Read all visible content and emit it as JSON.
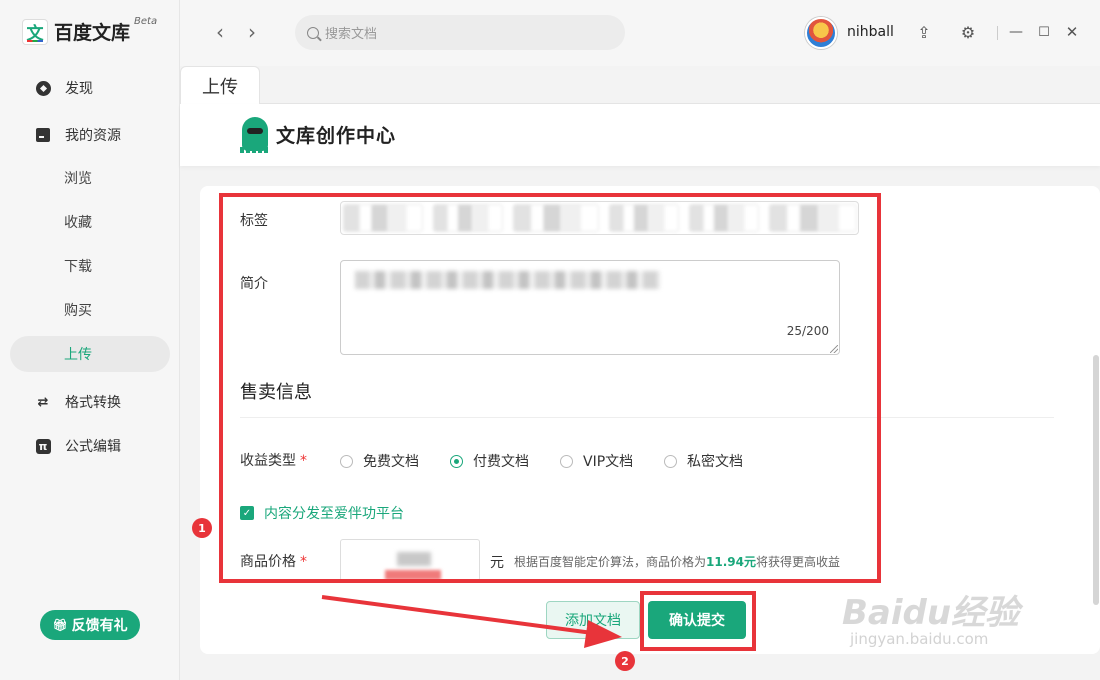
{
  "app": {
    "name": "百度文库",
    "beta": "Beta",
    "logo_char": "文"
  },
  "sidebar": {
    "items": [
      {
        "label": "发现",
        "icon": "compass-icon"
      },
      {
        "label": "我的资源",
        "icon": "folder-icon"
      },
      {
        "label": "浏览"
      },
      {
        "label": "收藏"
      },
      {
        "label": "下载"
      },
      {
        "label": "购买"
      },
      {
        "label": "上传",
        "active": true
      },
      {
        "label": "格式转换",
        "icon": "swap-icon"
      },
      {
        "label": "公式编辑",
        "icon": "formula-icon"
      }
    ],
    "feedback_label": "反馈有礼"
  },
  "topbar": {
    "search_placeholder": "搜索文档",
    "username": "nihball"
  },
  "tab": {
    "label": "上传"
  },
  "studio": {
    "name": "文库创作中心"
  },
  "form": {
    "tags_label": "标签",
    "intro_label": "简介",
    "intro_counter": "25/200",
    "sale_section_title": "售卖信息",
    "revenue_type_label": "收益类型",
    "required_mark": "*",
    "revenue_options": [
      {
        "label": "免费文档",
        "selected": false
      },
      {
        "label": "付费文档",
        "selected": true
      },
      {
        "label": "VIP文档",
        "selected": false
      },
      {
        "label": "私密文档",
        "selected": false
      }
    ],
    "distribute_checkbox": {
      "label": "内容分发至爱伴功平台",
      "checked": true
    },
    "price_label": "商品价格",
    "price_unit": "元",
    "price_hint_prefix": "根据百度智能定价算法，商品价格为",
    "price_hint_value": "11.94元",
    "price_hint_suffix": "将获得更高收益"
  },
  "buttons": {
    "add_doc": "添加文档",
    "submit": "确认提交"
  },
  "annotations": {
    "badge1": "1",
    "badge2": "2"
  },
  "watermark": {
    "brand": "Baidu经验",
    "url": "jingyan.baidu.com"
  },
  "colors": {
    "accent": "#1aa77b",
    "annotation_red": "#e8343a"
  }
}
